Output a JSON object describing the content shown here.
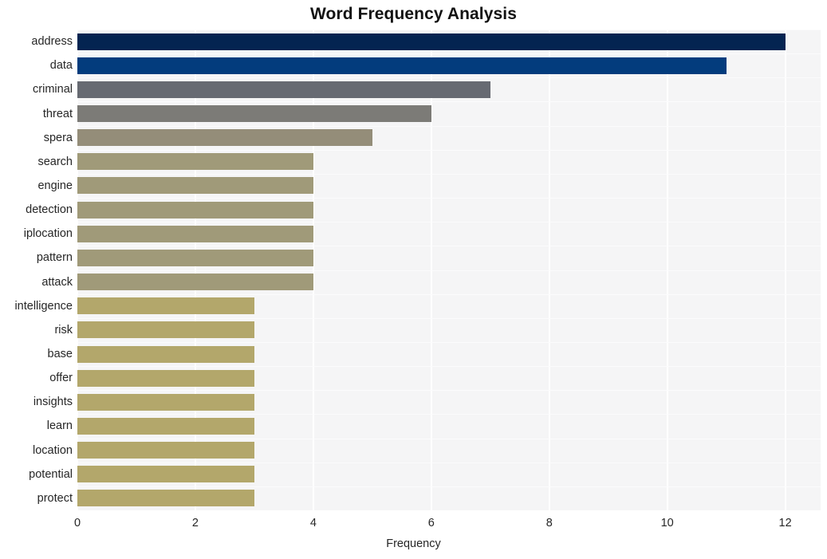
{
  "chart_data": {
    "type": "bar",
    "orientation": "horizontal",
    "title": "Word Frequency Analysis",
    "xlabel": "Frequency",
    "ylabel": "",
    "xlim": [
      0,
      12.6
    ],
    "xticks": [
      0,
      2,
      4,
      6,
      8,
      10,
      12
    ],
    "xtick_labels": [
      "0",
      "2",
      "4",
      "6",
      "8",
      "10",
      "12"
    ],
    "grid": true,
    "legend": null,
    "categories": [
      "address",
      "data",
      "criminal",
      "threat",
      "spera",
      "search",
      "engine",
      "detection",
      "iplocation",
      "pattern",
      "attack",
      "intelligence",
      "risk",
      "base",
      "offer",
      "insights",
      "learn",
      "location",
      "potential",
      "protect"
    ],
    "values": [
      12,
      11,
      7,
      6,
      5,
      4,
      4,
      4,
      4,
      4,
      4,
      3,
      3,
      3,
      3,
      3,
      3,
      3,
      3,
      3
    ],
    "bar_colors": [
      "#042451",
      "#033c7d",
      "#676a72",
      "#7c7b77",
      "#948d79",
      "#a09a79",
      "#a09a79",
      "#a09a79",
      "#a09a79",
      "#a09a79",
      "#a09a79",
      "#b3a76b",
      "#b3a76b",
      "#b3a76b",
      "#b3a76b",
      "#b3a76b",
      "#b3a76b",
      "#b3a76b",
      "#b3a76b",
      "#b3a76b"
    ],
    "plot_background": "#f5f5f6",
    "gridline_color": "#ffffff",
    "figure_background": "#ffffff",
    "title_color": "#121212",
    "tick_label_color": "#262626"
  }
}
